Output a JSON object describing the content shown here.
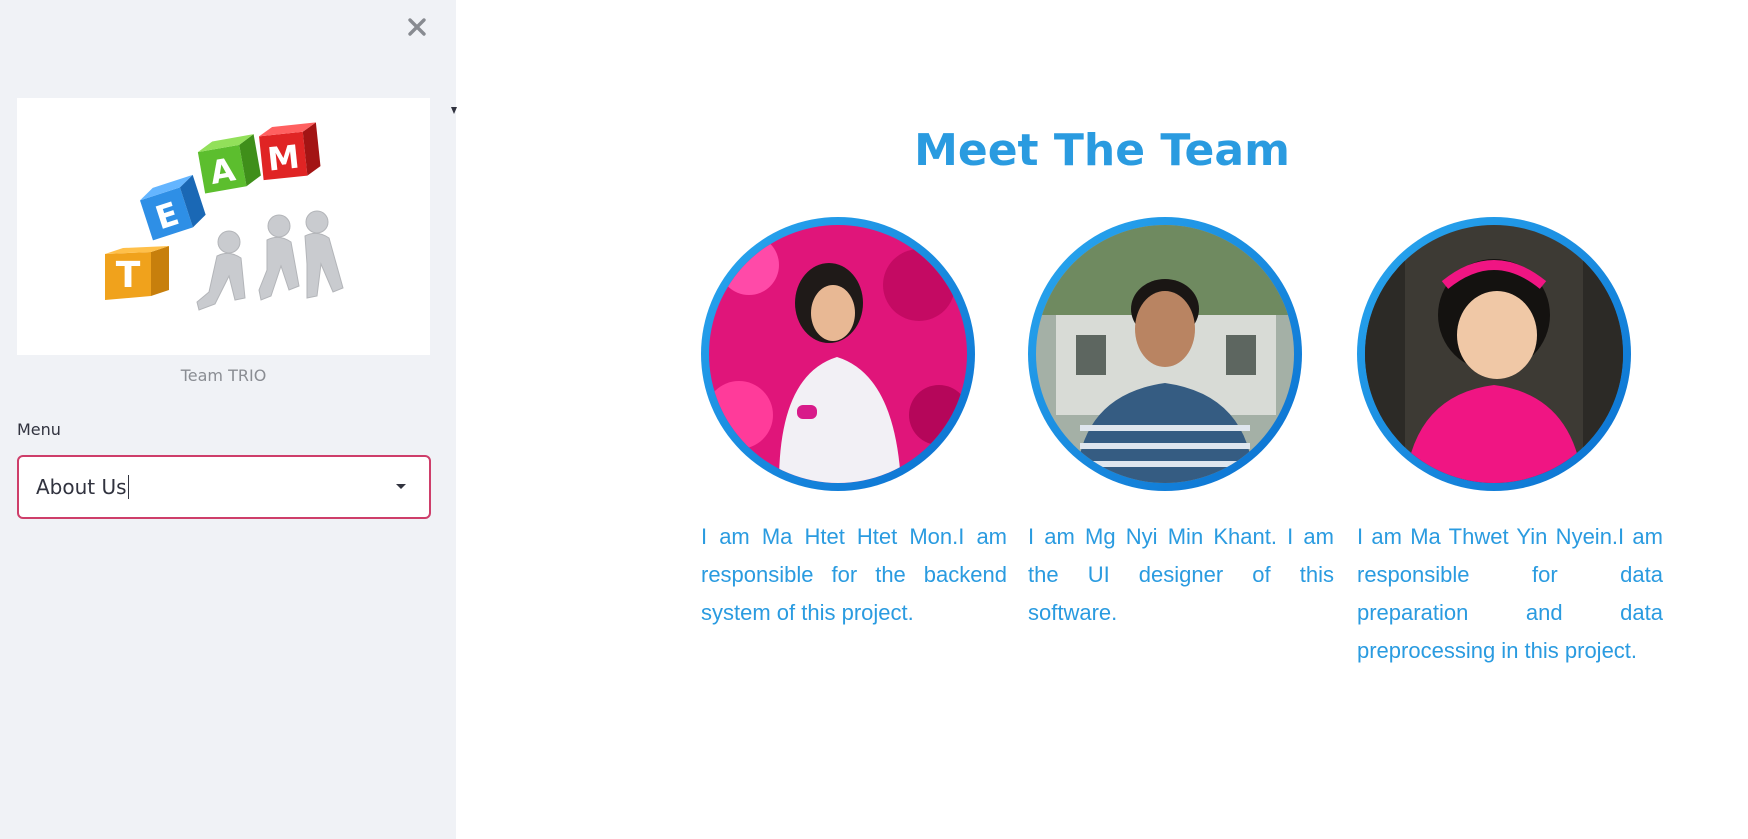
{
  "sidebar": {
    "close_icon": "close-icon",
    "logo": {
      "cubes": [
        "T",
        "E",
        "A",
        "M"
      ],
      "caption": "Team TRIO"
    },
    "menu": {
      "label": "Menu",
      "selected": "About Us",
      "dropdown_icon": "chevron-down-icon"
    }
  },
  "main": {
    "title": "Meet The Team",
    "members": [
      {
        "bio": "I am Ma Htet Htet Mon.I am responsible for the backend system of this project.",
        "photo_bg": "#e0157a",
        "shirt": "#f2f0f5"
      },
      {
        "bio": "I am Mg Nyi Min Khant. I am the UI designer of this software.",
        "photo_bg": "#8a9a8c",
        "shirt": "#355c82"
      },
      {
        "bio": "I am Ma Thwet Yin Nyein.I am responsible for data preparation and data preprocessing in this project.",
        "photo_bg": "#3d3a34",
        "shirt": "#f01583"
      }
    ]
  },
  "colors": {
    "accent": "#2a9be0",
    "select_border": "#ce3e6a",
    "sidebar_bg": "#f0f2f6"
  }
}
